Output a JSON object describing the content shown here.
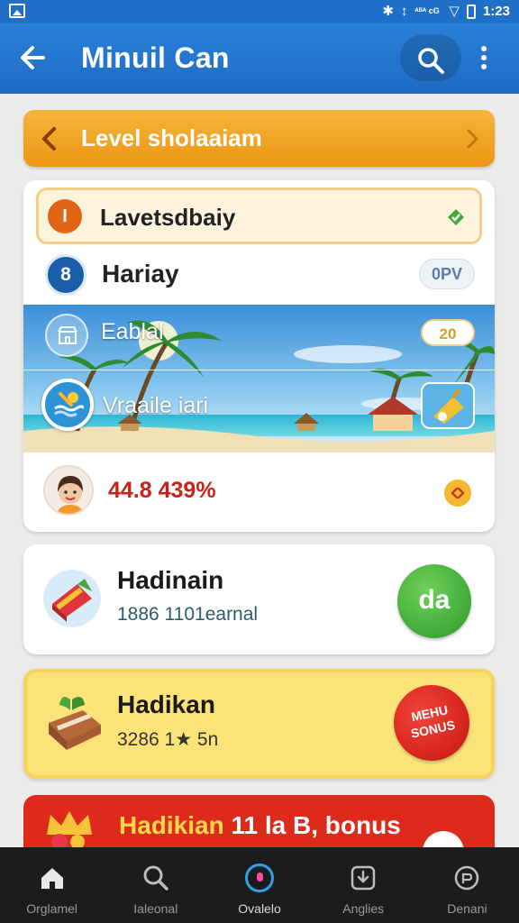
{
  "status_bar": {
    "time": "1:23",
    "icons": [
      "image-icon",
      "bluetooth-icon",
      "vibrate-icon",
      "signal-icon",
      "wifi-icon",
      "battery-icon"
    ],
    "network_label": "ᴬᴮᴬ\ncG"
  },
  "app_bar": {
    "title": "Minuil Can",
    "back_icon": "arrow-left-icon",
    "search_icon": "search-icon",
    "more_icon": "more-vertical-icon"
  },
  "level_banner": {
    "title": "Level sholaaiam",
    "color": "#ec9614"
  },
  "main_card": {
    "row1": {
      "badge": "I",
      "label": "Lavetsdbaiy"
    },
    "row2": {
      "badge": "8",
      "label": "Hariay",
      "pill": "0PV"
    },
    "beach": {
      "label1": "Eablal",
      "pill1": "20",
      "label2": "Vraaile iari"
    },
    "row4": {
      "value": "44.8 439%"
    }
  },
  "card2": {
    "title": "Hadinain",
    "subtitle": "1886 1101earnal",
    "button": "da"
  },
  "card3": {
    "title": "Hadikan",
    "subtitle": "3286 1★ 5n",
    "badge_line1": "MEHU",
    "badge_line2": "SONUS"
  },
  "card4": {
    "title_yellow": "Hadikian",
    "title_white": " 11 la B, bonus"
  },
  "bottom_nav": {
    "items": [
      {
        "label": "Orglamel",
        "icon": "home-icon"
      },
      {
        "label": "Ialeonal",
        "icon": "search-icon"
      },
      {
        "label": "Ovalelo",
        "icon": "games-icon"
      },
      {
        "label": "Anglies",
        "icon": "download-icon"
      },
      {
        "label": "Denani",
        "icon": "profile-icon"
      }
    ],
    "active_index": 2
  }
}
